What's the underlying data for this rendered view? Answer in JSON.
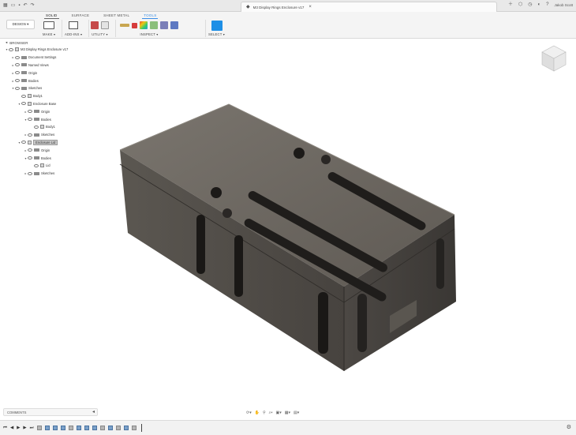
{
  "window": {
    "document_title": "M3 Display Rings Enclosure v17",
    "user_label": "Jakob Scott"
  },
  "toolbar": {
    "workspace_tabs": [
      "SOLID",
      "SURFACE",
      "SHEET METAL",
      "TOOLS"
    ],
    "active_tab": "SOLID",
    "design_button": "DESIGN ▾",
    "groups": [
      {
        "label": "MAKE ▾"
      },
      {
        "label": "ADD-INS ▾"
      },
      {
        "label": "UTILITY ▾"
      },
      {
        "label": "INSPECT ▾"
      },
      {
        "label": "SELECT ▾"
      }
    ]
  },
  "browser": {
    "header": "BROWSER",
    "rows": [
      {
        "label": "M3 Display Rings Enclosure v17",
        "indent": 0,
        "arrow": "▾",
        "icon": "box"
      },
      {
        "label": "Document Settings",
        "indent": 1,
        "arrow": "▸",
        "icon": "folder"
      },
      {
        "label": "Named Views",
        "indent": 1,
        "arrow": "▸",
        "icon": "folder"
      },
      {
        "label": "Origin",
        "indent": 1,
        "arrow": "▸",
        "icon": "folder"
      },
      {
        "label": "Bodies",
        "indent": 1,
        "arrow": "▸",
        "icon": "folder"
      },
      {
        "label": "Sketches",
        "indent": 1,
        "arrow": "▾",
        "icon": "folder"
      },
      {
        "label": "Body1",
        "indent": 2,
        "arrow": "",
        "icon": "box"
      },
      {
        "label": "Enclosure Base",
        "indent": 2,
        "arrow": "▾",
        "icon": "box"
      },
      {
        "label": "Origin",
        "indent": 3,
        "arrow": "▸",
        "icon": "folder"
      },
      {
        "label": "Bodies",
        "indent": 3,
        "arrow": "▾",
        "icon": "folder"
      },
      {
        "label": "Body1",
        "indent": 4,
        "arrow": "",
        "icon": "box"
      },
      {
        "label": "Sketches",
        "indent": 3,
        "arrow": "▸",
        "icon": "folder"
      },
      {
        "label": "Enclosure Lid",
        "indent": 2,
        "arrow": "▾",
        "icon": "box",
        "selected": true
      },
      {
        "label": "Origin",
        "indent": 3,
        "arrow": "▸",
        "icon": "folder"
      },
      {
        "label": "Bodies",
        "indent": 3,
        "arrow": "▾",
        "icon": "folder"
      },
      {
        "label": "Lid",
        "indent": 4,
        "arrow": "",
        "icon": "box"
      },
      {
        "label": "Sketches",
        "indent": 3,
        "arrow": "▸",
        "icon": "folder"
      }
    ]
  },
  "comments": {
    "label": "COMMENTS"
  },
  "icons": {
    "grid": "grid-icon",
    "save": "save-icon",
    "undo": "undo-icon",
    "redo": "redo-icon",
    "close": "close-icon",
    "add": "plus-icon",
    "help": "help-icon",
    "bell": "bell-icon",
    "settings": "gear-icon"
  },
  "colors": {
    "model_top": "#6f6a63",
    "model_front": "#4e4a45",
    "model_side": "#3f3c38",
    "accent": "#3a8ee6"
  }
}
